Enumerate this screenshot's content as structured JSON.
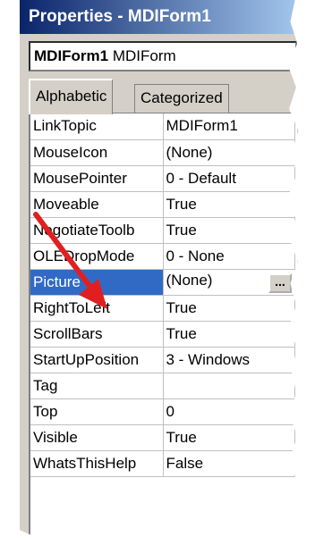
{
  "window": {
    "title": "Properties - MDIForm1"
  },
  "object_selector": {
    "name": "MDIForm1",
    "type": "MDIForm"
  },
  "tabs": [
    {
      "label": "Alphabetic",
      "active": true
    },
    {
      "label": "Categorized",
      "active": false
    }
  ],
  "properties": [
    {
      "name": "LinkTopic",
      "value": "MDIForm1"
    },
    {
      "name": "MouseIcon",
      "value": "(None)"
    },
    {
      "name": "MousePointer",
      "value": "0 - Default"
    },
    {
      "name": "Moveable",
      "value": "True"
    },
    {
      "name": "NegotiateToolb",
      "value": "True"
    },
    {
      "name": "OLEDropMode",
      "value": "0 - None"
    },
    {
      "name": "Picture",
      "value": "(None)",
      "selected": true,
      "ellipsis": "..."
    },
    {
      "name": "RightToLeft",
      "value": "True"
    },
    {
      "name": "ScrollBars",
      "value": "True"
    },
    {
      "name": "StartUpPosition",
      "value": "3 - Windows"
    },
    {
      "name": "Tag",
      "value": ""
    },
    {
      "name": "Top",
      "value": "0"
    },
    {
      "name": "Visible",
      "value": "True"
    },
    {
      "name": "WhatsThisHelp",
      "value": "False"
    }
  ],
  "colors": {
    "title_gradient_start": "#0a246a",
    "selection": "#316ac5",
    "annotation_arrow": "#e02020"
  },
  "icons": {
    "annotation": "red-arrow-icon"
  }
}
